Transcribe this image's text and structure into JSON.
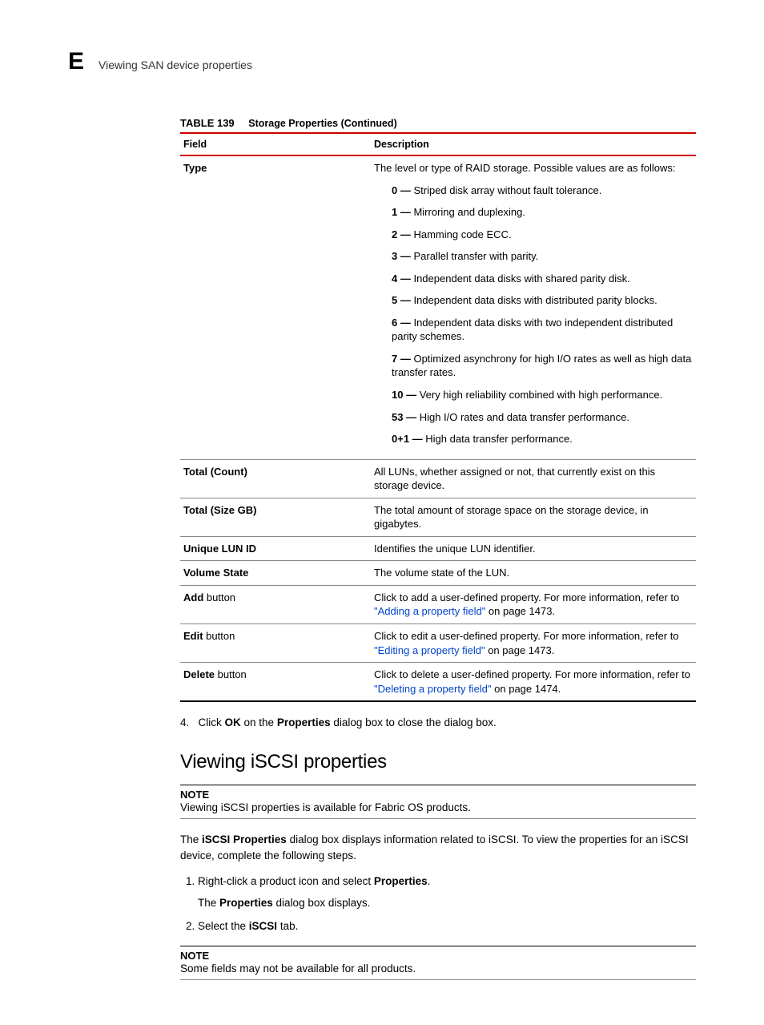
{
  "header": {
    "letter": "E",
    "title": "Viewing SAN device properties"
  },
  "table": {
    "number": "TABLE 139",
    "title": "Storage Properties (Continued)",
    "col_field": "Field",
    "col_desc": "Description",
    "type_row": {
      "field": "Type",
      "intro": "The level or type of RAID storage. Possible values are as follows:",
      "items": [
        {
          "k": "0",
          "t": "Striped disk array without fault tolerance."
        },
        {
          "k": "1",
          "t": "Mirroring and duplexing."
        },
        {
          "k": "2",
          "t": "Hamming code ECC."
        },
        {
          "k": "3",
          "t": "Parallel transfer with parity."
        },
        {
          "k": "4",
          "t": "Independent data disks with shared parity disk."
        },
        {
          "k": "5",
          "t": "Independent data disks with distributed parity blocks."
        },
        {
          "k": "6",
          "t": "Independent data disks with two independent distributed parity schemes."
        },
        {
          "k": "7",
          "t": "Optimized asynchrony for high I/O rates as well as high data transfer rates."
        },
        {
          "k": "10",
          "t": "Very high reliability combined with high performance."
        },
        {
          "k": "53",
          "t": "High I/O rates and data transfer performance."
        },
        {
          "k": "0+1",
          "t": "High data transfer performance."
        }
      ]
    },
    "rows": [
      {
        "field": "Total (Count)",
        "desc": "All LUNs, whether assigned or not, that currently exist on this storage device."
      },
      {
        "field": "Total (Size GB)",
        "desc": "The total amount of storage space on the storage device, in gigabytes."
      },
      {
        "field": "Unique LUN ID",
        "desc": "Identifies the unique LUN identifier."
      },
      {
        "field": "Volume State",
        "desc": "The volume state of the LUN."
      }
    ],
    "add": {
      "field_bold": "Add",
      "field_rest": " button",
      "pre": "Click to add a user-defined property. For more information, refer to ",
      "link": "\"Adding a property field\"",
      "post": " on page 1473."
    },
    "edit": {
      "field_bold": "Edit",
      "field_rest": " button",
      "pre": "Click to edit a user-defined property. For more information, refer to ",
      "link": "\"Editing a property field\"",
      "post": " on page 1473."
    },
    "del": {
      "field_bold": "Delete",
      "field_rest": " button",
      "pre": "Click to delete a user-defined property. For more information, refer to ",
      "link": "\"Deleting a property field\"",
      "post": " on page 1474."
    }
  },
  "step4": {
    "num": "4.",
    "pre": "Click ",
    "ok": "OK",
    "mid": " on the ",
    "props": "Properties",
    "post": " dialog box to close the dialog box."
  },
  "section": {
    "heading": "Viewing iSCSI properties",
    "note1": {
      "label": "NOTE",
      "body": "Viewing iSCSI properties is available for Fabric OS products."
    },
    "para": {
      "pre": "The ",
      "b1": "iSCSI Properties",
      "post": " dialog box displays information related to iSCSI. To view the properties for an iSCSI device, complete the following steps."
    },
    "steps": {
      "s1_pre": "Right-click a product icon and select ",
      "s1_b": "Properties",
      "s1_post": ".",
      "s1_sub_pre": "The ",
      "s1_sub_b": "Properties",
      "s1_sub_post": " dialog box displays.",
      "s2_pre": "Select the ",
      "s2_b": "iSCSI",
      "s2_post": " tab."
    },
    "note2": {
      "label": "NOTE",
      "body": "Some fields may not be available for all products."
    }
  }
}
